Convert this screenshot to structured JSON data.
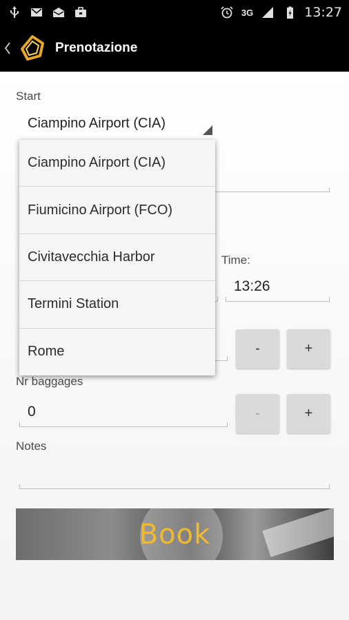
{
  "status_bar": {
    "time": "13:27",
    "network": "3G",
    "icons_left": [
      "usb-icon",
      "mail-icon",
      "mail-open-icon",
      "briefcase-icon"
    ],
    "icons_right": [
      "alarm-icon",
      "signal-icon",
      "battery-icon"
    ]
  },
  "action_bar": {
    "title": "Prenotazione"
  },
  "form": {
    "start_label": "Start",
    "start_value": "Ciampino Airport (CIA)",
    "time_label": "Time:",
    "time_value": "13:26",
    "baggages_label": "Nr baggages",
    "baggages_value": "0",
    "notes_label": "Notes",
    "minus": "-",
    "plus": "+",
    "book_label": "Book"
  },
  "dropdown": {
    "options": [
      "Ciampino Airport (CIA)",
      "Fiumicino Airport (FCO)",
      "Civitavecchia Harbor",
      "Termini Station",
      "Rome"
    ]
  },
  "colors": {
    "accent": "#f0b92f",
    "bar": "#000000"
  }
}
